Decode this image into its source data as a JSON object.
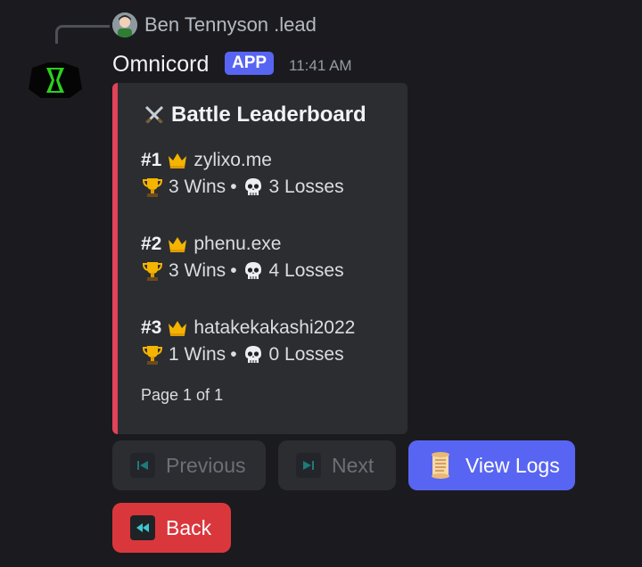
{
  "reply": {
    "username": "Ben Tennyson .lead"
  },
  "message": {
    "author": "Omnicord",
    "badge": "APP",
    "timestamp": "11:41 AM"
  },
  "embed": {
    "accent_color": "#e0435a",
    "title": "Battle Leaderboard",
    "entries": [
      {
        "rank": "#1",
        "name": "zylixo.me",
        "wins": "3 Wins",
        "losses": "3 Losses"
      },
      {
        "rank": "#2",
        "name": "phenu.exe",
        "wins": "3 Wins",
        "losses": "4 Losses"
      },
      {
        "rank": "#3",
        "name": "hatakekakashi2022",
        "wins": "1 Wins",
        "losses": "0 Losses"
      }
    ],
    "separator": "•",
    "footer": "Page 1 of 1"
  },
  "buttons": {
    "previous": "Previous",
    "next": "Next",
    "view_logs": "View Logs",
    "back": "Back"
  },
  "icons": {
    "title": "crossed-swords-icon",
    "rank": "crown-icon",
    "wins": "trophy-icon",
    "losses": "skull-icon",
    "logs": "scroll-icon"
  }
}
